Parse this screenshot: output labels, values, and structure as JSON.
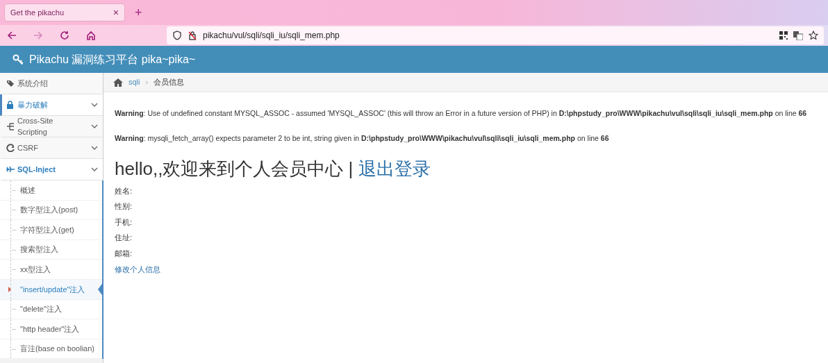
{
  "browser": {
    "tab": {
      "title": "Get the pikachu",
      "close": "×"
    },
    "new_tab": "+",
    "address": "pikachu/vul/sqli/sqli_iu/sqli_mem.php"
  },
  "header": {
    "title": "Pikachu 漏洞练习平台 pika~pika~"
  },
  "sidebar": {
    "items": [
      {
        "label": "系统介绍",
        "kind": "link",
        "highlighted": false,
        "expanded": false
      },
      {
        "label": "暴力破解",
        "kind": "menu",
        "highlighted": true,
        "expanded": false
      },
      {
        "label": "Cross-Site Scripting",
        "kind": "menu",
        "highlighted": false,
        "expanded": false
      },
      {
        "label": "CSRF",
        "kind": "menu",
        "highlighted": false,
        "expanded": false
      },
      {
        "label": "SQL-Inject",
        "kind": "menu",
        "highlighted": true,
        "expanded": true,
        "children": [
          {
            "label": "概述",
            "selected": false
          },
          {
            "label": "数字型注入(post)",
            "selected": false
          },
          {
            "label": "字符型注入(get)",
            "selected": false
          },
          {
            "label": "搜索型注入",
            "selected": false
          },
          {
            "label": "xx型注入",
            "selected": false
          },
          {
            "label": "\"insert/update\"注入",
            "selected": true
          },
          {
            "label": "\"delete\"注入",
            "selected": false
          },
          {
            "label": "\"http header\"注入",
            "selected": false
          },
          {
            "label": "盲注(base on boolian)",
            "selected": false
          }
        ]
      }
    ]
  },
  "breadcrumb": {
    "link": "sqli",
    "separator": "›",
    "current": "会员信息"
  },
  "warnings": [
    "**Warning**: Use of undefined constant MYSQL_ASSOC - assumed 'MYSQL_ASSOC' (this will throw an Error in a future version of PHP) in **D:\\phpstudy_pro\\WWW\\pikachu\\vul\\sqli\\sqli_iu\\sqli_mem.php** on line **66**",
    "**Warning**: mysqli_fetch_array() expects parameter 2 to be int, string given in **D:\\phpstudy_pro\\WWW\\pikachu\\vul\\sqli\\sqli_iu\\sqli_mem.php** on line **66**"
  ],
  "member": {
    "greeting": "hello,,欢迎来到个人会员中心 |",
    "logout": "退出登录",
    "fields": [
      "姓名:",
      "性别:",
      "手机:",
      "住址:",
      "邮箱:"
    ],
    "edit_link": "修改个人信息"
  }
}
